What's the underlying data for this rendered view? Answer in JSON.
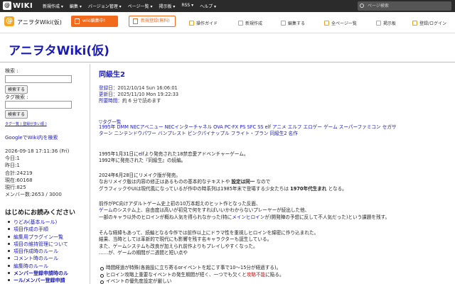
{
  "topbar": {
    "logo_mark": "@",
    "logo_text": "WIKI",
    "menu": [
      "新規作成 ▾",
      "編集 ▾",
      "バージョン管理 ▾",
      "ページ一覧 ▾",
      "掲示板 ▾",
      "RSS ▾",
      "ヘルプ ▾"
    ],
    "search_placeholder": "ページ検索"
  },
  "header": {
    "site_logo": "@",
    "site_name": "アニヲタWiki(仮)",
    "btn_editing": "wiki編集中!",
    "btn_register": "新規登録(無料)",
    "nav": [
      "操作ガイド",
      "新規作成",
      "編集する",
      "全ページ一覧",
      "掲示板",
      "登録/ログイン"
    ]
  },
  "wiki_title": "アニヲタWiki(仮)",
  "sidebar": {
    "search_label": "検索 :",
    "search_button": "検索する",
    "tag_label": "タグ検索 :",
    "tag_button": "検索する",
    "tag_list_link": "タグ一覧 ( 登録が多い順 )",
    "google_link": "GoogleでWiki内を検索",
    "stats": [
      "2026-09-18 17:11:36 (Fri)",
      "今日:1",
      "昨日:1",
      "合計:24219",
      "現在:60168",
      "現行:825",
      "メンバー数:2653 / 3000"
    ],
    "guide_heading": "はじめにお読みください",
    "guide_items": [
      "りどみ(基本ルール)",
      "項目作成の手順",
      "編集用プラグイン一覧",
      "項目の維持管理について",
      "項目作成時のルール",
      "コメント時のルール",
      "編集時のルール",
      "メンバー登録申請時のル",
      "ール/メンバー登録申請"
    ]
  },
  "page": {
    "title": "同級生2",
    "created_label": "登録日",
    "created": "：2012/10/14 Sun 16:06:01",
    "updated_label": "更新日",
    "updated": "：2025/11/10 Mon 19:22:33",
    "reading_label": "所要時間",
    "reading": "：約 6 分で読めます",
    "tags_heading": "▽タグ一覧",
    "tags_line1": "1995年 DMM NECアベニュー NECインターチャネル OVA PC-FX PS SFC SS elf アニメ エルフ エロゲー ゲーム スーパーファミコン セガサ",
    "tags_line2": "ターン ニンテンドウパワー バンプレスト ピンクパイナップル フライト・プラン 同級生2 名作",
    "p1": [
      "1995年1月31日に",
      "elf",
      "より発売された18禁恋愛アドベンチャーゲーム。",
      "1992年に発売された『同級生』の続編。"
    ],
    "p2": [
      "2024年6月28日にリメイク版が発売。",
      "なおリメイク版は内容の修正はあるものの基本的なテキストや ",
      "設定は同一",
      " なので",
      "グラフィックやUIは現代風になっているが作中の時系列は1985年末で登場する少女たちは ",
      "1970年代生まれ",
      " となる。"
    ],
    "p3": [
      "前作がPC向けアダルトゲーム史上初の10万本超えのヒット作となった反面、",
      "ゲーム",
      "のシステム上、自由度は高いが初見で何をすればいいかわからないプレーヤーが続出した他、",
      "一部のキャラ以外のヒロインが概ね人気を得られなかった(特に",
      "メインヒロイン",
      "が)開発陣の予想に反して不人気だった)という課題を残す。"
    ],
    "p4": [
      "そんな経緯もあって、続編となる今作では前作以上にドラマ性を重視しヒロインを綿密に作り込まれた。",
      "結果、当時としては革新的で現代にも影響を残す名キャラクターも誕生している。",
      "また、ゲームシステムも改良が加えられ前作よりもプレイしやすくなった。",
      "……が、ゲームの期間が二週間と短い点や"
    ],
    "bullets": [
      "時間経過が特殊(各施設に立ち寄るorイベントを起こす事で10〜15分が経過する)。",
      "ヒロイン攻略上重要なイベントの発生期間が短く、一つでも欠くと",
      "攻略不能",
      "に陥る。",
      "イベントの優先度設定が厳しい"
    ]
  },
  "colors": {
    "link": "#1a1ab8",
    "accent": "#f26b1d",
    "topbar": "#2b2b2b",
    "red": "#d01010"
  }
}
